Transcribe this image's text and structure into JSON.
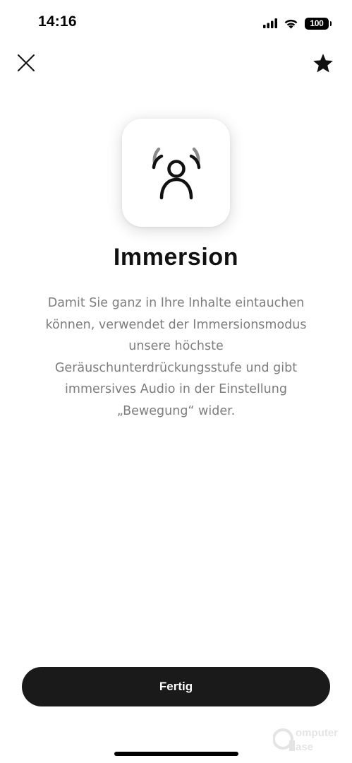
{
  "status_bar": {
    "time": "14:16",
    "battery_level": "100",
    "signal_icon": "cellular-signal-icon",
    "wifi_icon": "wifi-icon",
    "battery_icon": "battery-icon"
  },
  "nav": {
    "close_icon": "close-icon",
    "favorite_icon": "star-icon"
  },
  "mode": {
    "icon": "immersion-listener-icon",
    "title": "Immersion",
    "description_lines": [
      "Damit Sie ganz in Ihre Inhalte eintauchen",
      "können, verwendet der Immersionsmodus",
      "unsere höchste",
      "Geräuschunterdrückungsstufe und gibt",
      "immersives Audio in der Einstellung",
      "„Bewegung“ wider."
    ]
  },
  "actions": {
    "done_label": "Fertig"
  },
  "watermark": {
    "text_line1": "Computer",
    "text_line2": "Base"
  },
  "colors": {
    "background": "#ffffff",
    "text_primary": "#111111",
    "text_secondary": "#7d7d7d",
    "button_background": "#1a1a1a",
    "button_text": "#ffffff",
    "icon_accent_gray": "#8a8a8a"
  }
}
